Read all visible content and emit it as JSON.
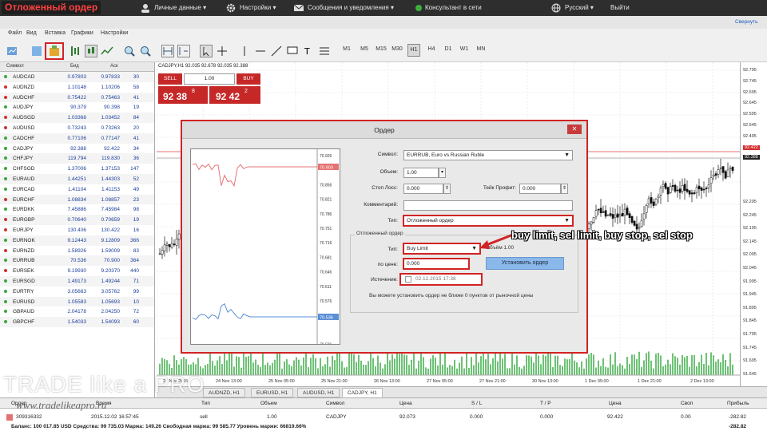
{
  "top": {
    "title": "Отложенный ордер",
    "personal": "Личные данные",
    "settings": "Настройки",
    "messages": "Сообщения и уведомления",
    "consultant": "Консультант в сети",
    "language": "Русский",
    "exit": "Выйти",
    "collapse": "Свернуть"
  },
  "menu": [
    "Файл",
    "Вид",
    "Вставка",
    "Графики",
    "Настройки"
  ],
  "timeframes": [
    "M1",
    "M5",
    "M15",
    "M30",
    "H1",
    "H4",
    "D1",
    "W1",
    "MN"
  ],
  "active_timeframe": "H1",
  "watch": {
    "headers": {
      "symbol": "Символ",
      "bid": "Бид",
      "ask": "Аск"
    },
    "rows": [
      {
        "s": "AUDCAD",
        "b": "0.97803",
        "a": "0.97833",
        "p": "30",
        "c": "#3aa83a"
      },
      {
        "s": "AUDNZD",
        "b": "1.10148",
        "a": "1.10206",
        "p": "58",
        "c": "#d23030"
      },
      {
        "s": "AUDCHF",
        "b": "0.75422",
        "a": "0.75463",
        "p": "41",
        "c": "#d23030"
      },
      {
        "s": "AUDJPY",
        "b": "90.379",
        "a": "90.398",
        "p": "19",
        "c": "#3aa83a"
      },
      {
        "s": "AUDSGD",
        "b": "1.03368",
        "a": "1.03452",
        "p": "84",
        "c": "#d23030"
      },
      {
        "s": "AUDUSD",
        "b": "0.73243",
        "a": "0.73263",
        "p": "20",
        "c": "#d23030"
      },
      {
        "s": "CADCHF",
        "b": "0.77106",
        "a": "0.77147",
        "p": "41",
        "c": "#3aa83a"
      },
      {
        "s": "CADJPY",
        "b": "92.388",
        "a": "92.422",
        "p": "34",
        "c": "#3aa83a"
      },
      {
        "s": "CHFJPY",
        "b": "119.794",
        "a": "119.830",
        "p": "36",
        "c": "#3aa83a"
      },
      {
        "s": "CHFSGD",
        "b": "1.37006",
        "a": "1.37153",
        "p": "147",
        "c": "#3aa83a"
      },
      {
        "s": "EURAUD",
        "b": "1.44251",
        "a": "1.44303",
        "p": "52",
        "c": "#3aa83a"
      },
      {
        "s": "EURCAD",
        "b": "1.41104",
        "a": "1.41153",
        "p": "49",
        "c": "#3aa83a"
      },
      {
        "s": "EURCHF",
        "b": "1.08834",
        "a": "1.08857",
        "p": "23",
        "c": "#d23030"
      },
      {
        "s": "EURDKK",
        "b": "7.45886",
        "a": "7.45984",
        "p": "98",
        "c": "#3aa83a"
      },
      {
        "s": "EURGBP",
        "b": "0.70640",
        "a": "0.70659",
        "p": "19",
        "c": "#d23030"
      },
      {
        "s": "EURJPY",
        "b": "130.406",
        "a": "130.422",
        "p": "16",
        "c": "#d23030"
      },
      {
        "s": "EURNOK",
        "b": "9.12443",
        "a": "9.12809",
        "p": "366",
        "c": "#3aa83a"
      },
      {
        "s": "EURNZD",
        "b": "1.58926",
        "a": "1.59009",
        "p": "83",
        "c": "#d23030"
      },
      {
        "s": "EURRUB",
        "b": "70.536",
        "a": "70.900",
        "p": "364",
        "c": "#3aa83a"
      },
      {
        "s": "EURSEK",
        "b": "9.19930",
        "a": "9.20370",
        "p": "440",
        "c": "#d23030"
      },
      {
        "s": "EURSGD",
        "b": "1.49173",
        "a": "1.49244",
        "p": "71",
        "c": "#3aa83a"
      },
      {
        "s": "EURTRY",
        "b": "3.05663",
        "a": "3.05762",
        "p": "99",
        "c": "#3aa83a"
      },
      {
        "s": "EURUSD",
        "b": "1.05583",
        "a": "1.05693",
        "p": "10",
        "c": "#3aa83a"
      },
      {
        "s": "GBPAUD",
        "b": "2.04178",
        "a": "2.04250",
        "p": "72",
        "c": "#3aa83a"
      },
      {
        "s": "GBPCHF",
        "b": "1.54033",
        "a": "1.54093",
        "p": "60",
        "c": "#3aa83a"
      }
    ]
  },
  "chart": {
    "title": "CADJPY,H1  92.035 92.678 92.035 92.388",
    "sell": "SELL",
    "buy": "BUY",
    "lot": "1.00",
    "sell_big": "92 38",
    "sell_sup": "8",
    "buy_big": "92 42",
    "buy_sup": "2",
    "price_labels": [
      "92.795",
      "92.745",
      "92.695",
      "92.645",
      "92.595",
      "92.545",
      "92.495",
      "92.445",
      "92.422",
      "92.388",
      "92.295",
      "92.245",
      "92.195",
      "92.145",
      "92.095",
      "92.045",
      "91.995",
      "91.945",
      "91.895",
      "91.845",
      "91.795",
      "91.745",
      "91.695",
      "91.645"
    ],
    "time_labels": [
      "23 Nov 2015",
      "24 Nov 13:00",
      "25 Nov 05:00",
      "25 Nov 21:00",
      "26 Nov 13:00",
      "27 Nov 05:00",
      "27 Nov 21:00",
      "30 Nov 13:00",
      "1 Dec 05:00",
      "1 Dec 21:00",
      "2 Dec 13:00"
    ],
    "tabs": [
      "AUDNZD, H1",
      "EURUSD, H1",
      "AUDUSD, H1",
      "CADJPY, H1"
    ],
    "active_tab": "CADJPY, H1"
  },
  "dialog": {
    "title": "Ордер",
    "symbol_label": "Символ:",
    "symbol": "EURRUB, Euro vs Russian Ruble",
    "volume_label": "Объем:",
    "volume": "1.00",
    "sl_label": "Стоп Лосс:",
    "sl": "0.000",
    "tp_label": "Тейк Профит:",
    "tp": "0.000",
    "comment_label": "Комментарий:",
    "type_label": "Тип:",
    "type": "Отложенный ордер",
    "group_label": "Отложенный ордер",
    "ptype_label": "Тип:",
    "ptype": "Buy Limit",
    "price_label": "по цене:",
    "price": "0.000",
    "expiry_label": "Истечение:",
    "expiry": "02.12.2015 17:38",
    "volume_note": "Объём 1.00",
    "set_button": "Установить ордер",
    "info": "Вы можете установить ордер не ближе 0 пунктов от рыночной цены",
    "chart_labels": [
      "70.926",
      "70.900",
      "70.856",
      "70.821",
      "70.786",
      "70.751",
      "70.716",
      "70.681",
      "70.646",
      "70.611",
      "70.576",
      "70.541",
      "70.536",
      "70.506"
    ],
    "ask_tag": "70.900",
    "bid_tag": "70.536"
  },
  "callout": "buy limit, sel limit, buy stop, sel stop",
  "terminal": {
    "headers": [
      "Ордер",
      "Время",
      "Тип",
      "Объем",
      "Символ",
      "Цена",
      "S / L",
      "T / P",
      "Цена",
      "Своп",
      "Прибыль"
    ],
    "row": [
      "309316332",
      "2015.12.02 16:57:45",
      "sell",
      "1.00",
      "CADJPY",
      "92.073",
      "0.000",
      "0.000",
      "92.422",
      "0.00",
      "-282.82"
    ],
    "balance": "Баланс: 100 017.85 USD  Средства: 99 735.03  Маржа: 149.26  Свободная маржа: 99 585.77  Уровень маржи: 66819.66%",
    "total": "-282.82"
  },
  "watermark": {
    "brand": "TRADE like a PRO",
    "url": "www.tradelikeapro.ru"
  }
}
